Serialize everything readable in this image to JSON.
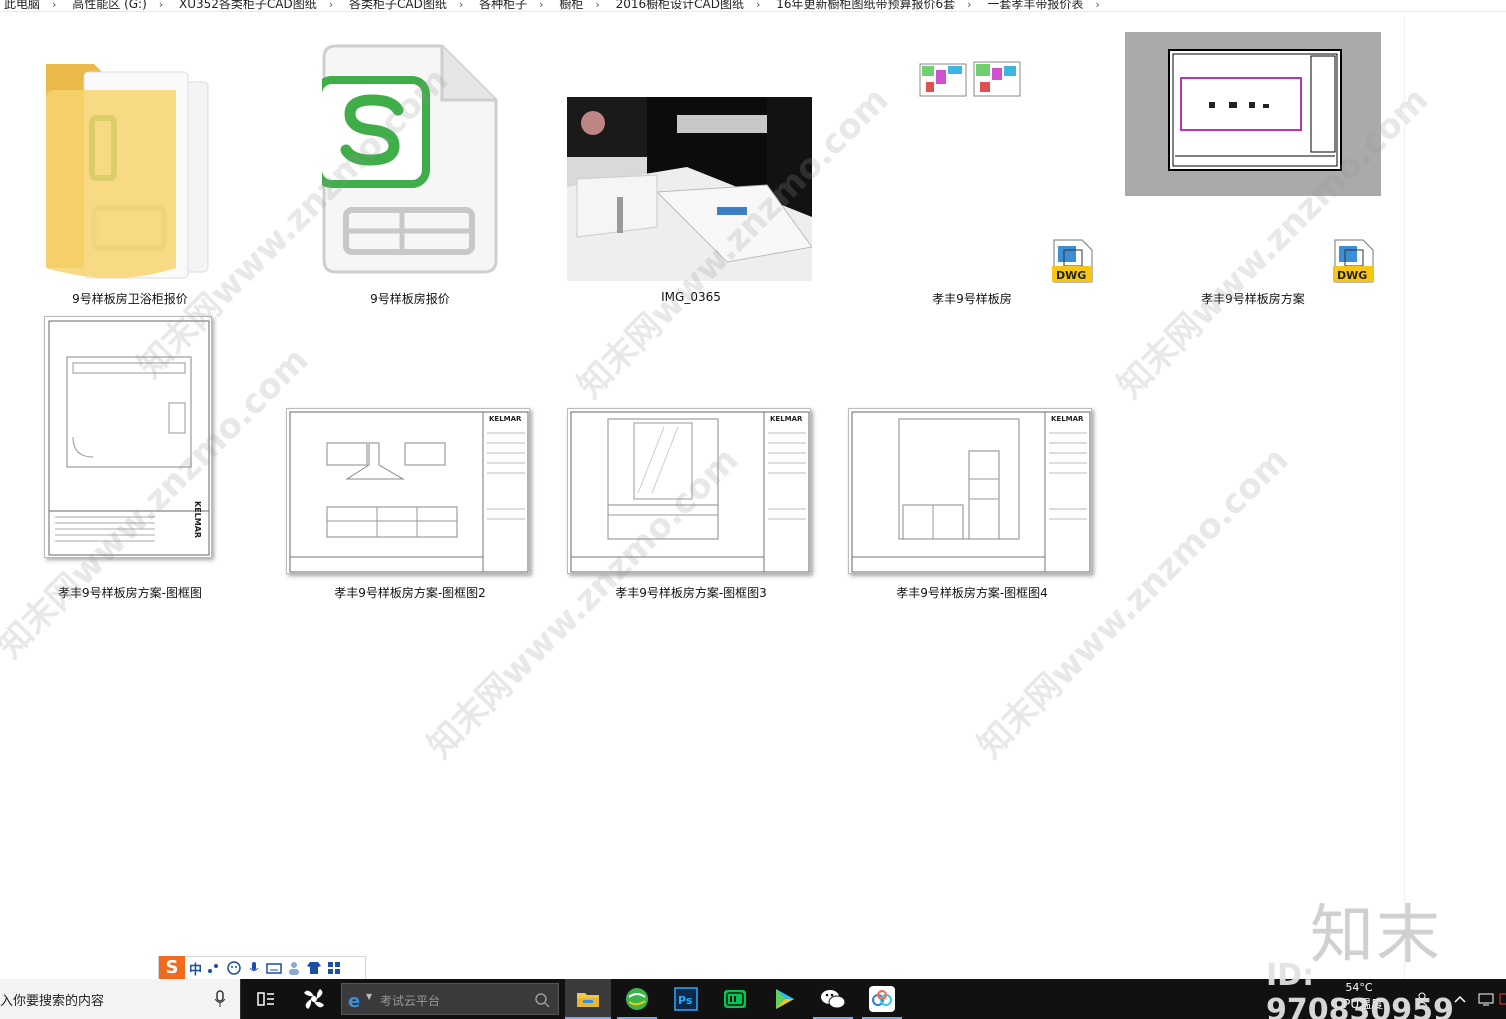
{
  "breadcrumb": [
    "此电脑",
    "高性能区 (G:)",
    "XU352各类柜子CAD图纸",
    "各类柜子CAD图纸",
    "各种柜子",
    "橱柜",
    "2016橱柜设计CAD图纸",
    "16年更新橱柜图纸带预算报价6套",
    "一套孝丰带报价表"
  ],
  "files": [
    {
      "name": "9号样板房卫浴柜报价",
      "type": "folder-spreadsheet-icon"
    },
    {
      "name": "9号样板房报价",
      "type": "spreadsheet-icon"
    },
    {
      "name": "IMG_0365",
      "type": "photo-thumbnail"
    },
    {
      "name": "孝丰9号样板房",
      "type": "dwg-icon"
    },
    {
      "name": "孝丰9号样板房方案",
      "type": "dwg-icon"
    },
    {
      "name": "孝丰9号样板房方案-图框图",
      "type": "drawing-thumbnail"
    },
    {
      "name": "孝丰9号样板房方案-图框图2",
      "type": "drawing-thumbnail"
    },
    {
      "name": "孝丰9号样板房方案-图框图3",
      "type": "drawing-thumbnail"
    },
    {
      "name": "孝丰9号样板房方案-图框图4",
      "type": "drawing-thumbnail"
    }
  ],
  "dwg_badge_text": "DWG",
  "drawing_brand": "KELMAR",
  "watermark": {
    "brand": "知末",
    "id_text": "ID: 970830959",
    "url": "知末网www.znzmo.com"
  },
  "ime": {
    "logo": "S",
    "mode": "中"
  },
  "taskbar": {
    "search_placeholder": "入你要搜索的内容",
    "ie_placeholder": "考试云平台",
    "tray_temp": "54°C",
    "tray_temp_label": "CPU温度"
  },
  "colors": {
    "taskbar": "#111112",
    "spreadsheet_green": "#3fae49",
    "folder_yellow": "#f7d36e",
    "dwg_yellow": "#f5c518",
    "ime_orange": "#f26a1b"
  }
}
